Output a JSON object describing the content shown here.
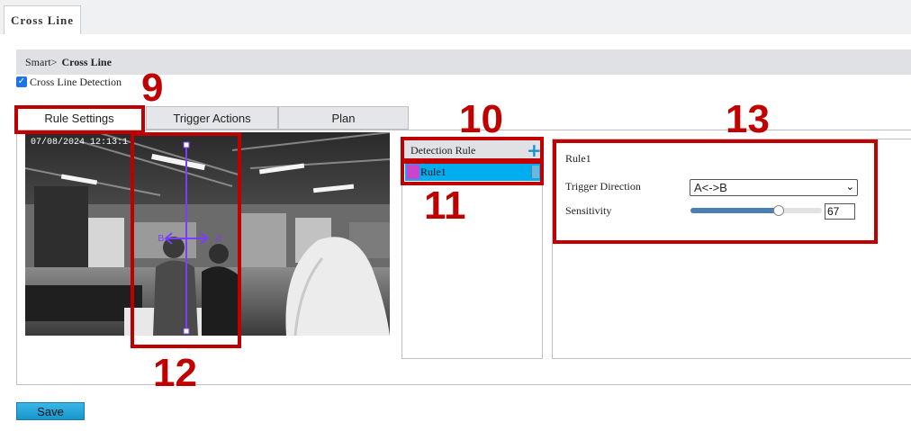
{
  "top_tab": {
    "label": "Cross Line"
  },
  "breadcrumb": {
    "parent": "Smart",
    "separator": ">",
    "current": "Cross Line"
  },
  "enable_checkbox": {
    "label": "Cross Line Detection",
    "checked": true
  },
  "tabs": [
    {
      "label": "Rule Settings",
      "active": true
    },
    {
      "label": "Trigger Actions",
      "active": false
    },
    {
      "label": "Plan",
      "active": false
    }
  ],
  "video": {
    "timestamp": "07/08/2024 12:13:1",
    "line_endpoint_a": "A",
    "line_endpoint_b": "B",
    "line_color": "#7b3cff"
  },
  "detection_rule": {
    "header": "Detection Rule",
    "add_icon": "plus-icon",
    "items": [
      {
        "name": "Rule1",
        "color": "#cc44cc"
      }
    ]
  },
  "rule_detail": {
    "title": "Rule1",
    "trigger_direction_label": "Trigger Direction",
    "trigger_direction_value": "A<->B",
    "sensitivity_label": "Sensitivity",
    "sensitivity_value": "67",
    "sensitivity_fraction": 0.67
  },
  "save_button": {
    "label": "Save"
  },
  "annotations": [
    {
      "number": "9"
    },
    {
      "number": "10"
    },
    {
      "number": "11"
    },
    {
      "number": "12"
    },
    {
      "number": "13"
    }
  ],
  "colors": {
    "accent": "#00aeef",
    "annotation_red": "#c00000",
    "button": "#1796cc"
  }
}
